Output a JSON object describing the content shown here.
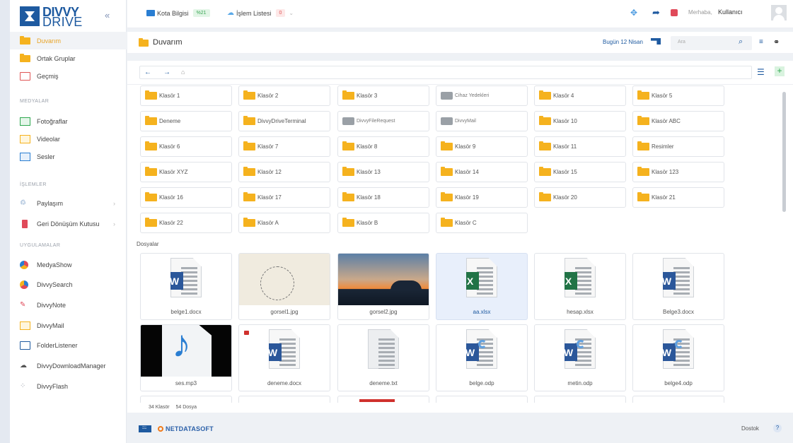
{
  "brand": {
    "line1": "DIVVY",
    "line2": "DRIVE"
  },
  "sidebar": {
    "items": [
      {
        "label": "Duvarım",
        "icon": "folder-icon",
        "active": true
      },
      {
        "label": "Ortak Gruplar",
        "icon": "shared-folder-icon"
      },
      {
        "label": "Geçmiş",
        "icon": "history-icon"
      }
    ],
    "media_heading": "MEDYALAR",
    "media": [
      {
        "label": "Fotoğraflar",
        "icon": "photo-icon"
      },
      {
        "label": "Videolar",
        "icon": "video-icon"
      },
      {
        "label": "Sesler",
        "icon": "audio-icon"
      }
    ],
    "ops_heading": "İŞLEMLER",
    "ops": [
      {
        "label": "Paylaşım",
        "icon": "share-icon"
      },
      {
        "label": "Geri Dönüşüm Kutusu",
        "icon": "trash-icon"
      }
    ],
    "apps_heading": "UYGULAMALAR",
    "apps": [
      {
        "label": "MedyaShow",
        "icon": "medyashow-icon"
      },
      {
        "label": "DivvySearch",
        "icon": "divvysearch-icon"
      },
      {
        "label": "DivvyNote",
        "icon": "pin-icon"
      },
      {
        "label": "DivvyMail",
        "icon": "mail-icon"
      },
      {
        "label": "FolderListener",
        "icon": "folderlistener-icon"
      },
      {
        "label": "DivvyDownloadManager",
        "icon": "download-cloud-icon"
      },
      {
        "label": "DivvyFlash",
        "icon": "flash-icon"
      }
    ]
  },
  "topbar": {
    "quota_label": "Kota Bilgisi",
    "quota_value": "%21",
    "tasks_label": "İşlem Listesi",
    "tasks_value": "0",
    "greeting": "Merhaba,",
    "user": "Kullanıcı"
  },
  "title": {
    "label": "Duvarım",
    "date": "Bugün 12 Nisan",
    "search_placeholder": "Ara"
  },
  "folders": [
    {
      "name": "Klasör 1"
    },
    {
      "name": "Klasör 2"
    },
    {
      "name": "Klasör 3"
    },
    {
      "name": "Cihaz Yedekleri",
      "gray": true
    },
    {
      "name": "Klasör 4"
    },
    {
      "name": "Klasör 5"
    },
    {
      "name": "Deneme"
    },
    {
      "name": "DivvyDriveTerminal"
    },
    {
      "name": "DivvyFileRequest",
      "gray": true
    },
    {
      "name": "DivvyMail",
      "gray": true
    },
    {
      "name": "Klasör 10"
    },
    {
      "name": "Klasör ABC"
    },
    {
      "name": "Klasör 6"
    },
    {
      "name": "Klasör 7"
    },
    {
      "name": "Klasör 8"
    },
    {
      "name": "Klasör 9"
    },
    {
      "name": "Klasör 11"
    },
    {
      "name": "Resimler"
    },
    {
      "name": "Klasör XYZ"
    },
    {
      "name": "Klasör 12"
    },
    {
      "name": "Klasör 13"
    },
    {
      "name": "Klasör 14"
    },
    {
      "name": "Klasör 15"
    },
    {
      "name": "Klasör 123"
    },
    {
      "name": "Klasör 16"
    },
    {
      "name": "Klasör 17"
    },
    {
      "name": "Klasör 18"
    },
    {
      "name": "Klasör 19"
    },
    {
      "name": "Klasör 20"
    },
    {
      "name": "Klasör 21"
    },
    {
      "name": "Klasör 22"
    },
    {
      "name": "Klasör A"
    },
    {
      "name": "Klasör B"
    },
    {
      "name": "Klasör C"
    }
  ],
  "files_heading": "Dosyalar",
  "files": [
    {
      "name": "belge1.docx",
      "kind": "word"
    },
    {
      "name": "gorsel1.jpg",
      "kind": "clock"
    },
    {
      "name": "gorsel2.jpg",
      "kind": "sunset"
    },
    {
      "name": "aa.xlsx",
      "kind": "excel",
      "selected": true
    },
    {
      "name": "hesap.xlsx",
      "kind": "excel"
    },
    {
      "name": "Belge3.docx",
      "kind": "word"
    },
    {
      "name": "ses.mp3",
      "kind": "mp3"
    },
    {
      "name": "deneme.docx",
      "kind": "word",
      "locked": true
    },
    {
      "name": "deneme.txt",
      "kind": "text"
    },
    {
      "name": "belge.odp",
      "kind": "odp"
    },
    {
      "name": "metin.odp",
      "kind": "odp"
    },
    {
      "name": "belge4.odp",
      "kind": "odp"
    }
  ],
  "status": {
    "folders": "34 Klasör",
    "files": "54 Dosya"
  },
  "footer": {
    "brand1": "DIVVY DRIVE",
    "brand2": "NETDATASOFT",
    "lang": "Dostok"
  },
  "colors": {
    "folder": "#f5b21e",
    "brand": "#1e5aa0",
    "word": "#2b579a",
    "excel": "#217346"
  }
}
